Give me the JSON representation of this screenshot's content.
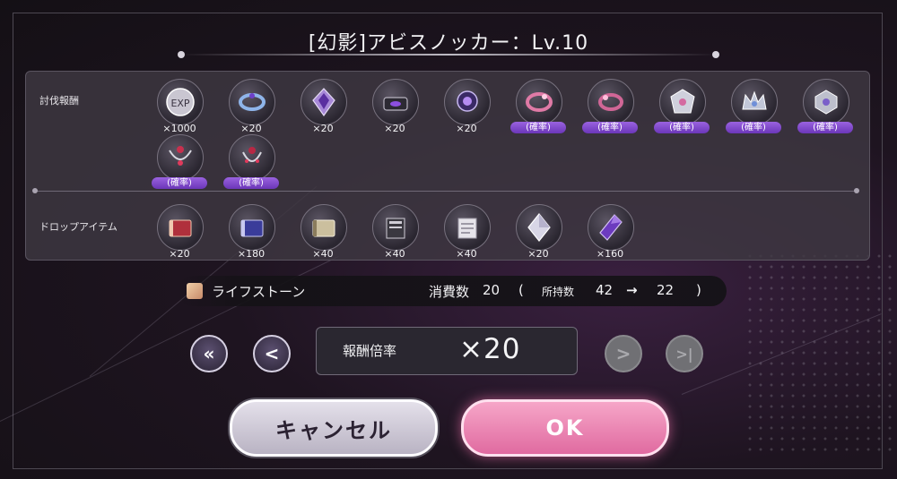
{
  "title": "[幻影]アビスノッカー：Lv.10",
  "sections": {
    "clear_reward_label": "討伐報酬",
    "drop_items_label": "ドロップアイテム"
  },
  "clear_rewards": [
    {
      "icon": "rank-exp-icon",
      "text": "EXP",
      "qty": "×1000"
    },
    {
      "icon": "blue-ring-icon",
      "qty": "×20"
    },
    {
      "icon": "purple-crystal-icon",
      "qty": "×20"
    },
    {
      "icon": "treasure-case-icon",
      "qty": "×20"
    },
    {
      "icon": "purple-orb-icon",
      "qty": "×20"
    },
    {
      "icon": "pink-bracelet-icon",
      "badge": "(確率)"
    },
    {
      "icon": "pink-ring-icon",
      "badge": "(確率)"
    },
    {
      "icon": "silver-crest-icon",
      "badge": "(確率)"
    },
    {
      "icon": "silver-crown-icon",
      "badge": "(確率)"
    },
    {
      "icon": "silver-emblem-icon",
      "badge": "(確率)"
    },
    {
      "icon": "ruby-necklace-icon",
      "badge": "(確率)"
    },
    {
      "icon": "ruby-pendant-icon",
      "badge": "(確率)"
    }
  ],
  "drop_items": [
    {
      "icon": "red-book-icon",
      "qty": "×20"
    },
    {
      "icon": "blue-book-icon",
      "qty": "×180"
    },
    {
      "icon": "beige-book-icon",
      "qty": "×40"
    },
    {
      "icon": "scroll-stack-icon",
      "qty": "×40"
    },
    {
      "icon": "paper-stack-icon",
      "qty": "×40"
    },
    {
      "icon": "diamond-crystal-icon",
      "qty": "×20"
    },
    {
      "icon": "purple-gem-icon",
      "qty": "×160"
    }
  ],
  "cost": {
    "item_name": "ライフストーン",
    "consume_label": "消費数",
    "consume_value": "20",
    "paren_open": "(",
    "owned_label": "所持数",
    "owned_before": "42",
    "arrow": "→",
    "owned_after": "22",
    "paren_close": ")"
  },
  "rate": {
    "label": "報酬倍率",
    "value": "×20"
  },
  "nav": {
    "first": "«",
    "prev": "<",
    "next": ">",
    "last": ">|"
  },
  "buttons": {
    "cancel": "キャンセル",
    "ok": "OK"
  },
  "colors": {
    "badge": "#8a4fd6",
    "ok_pink": "#f08cb8",
    "cancel_gray": "#d4cfdb"
  }
}
